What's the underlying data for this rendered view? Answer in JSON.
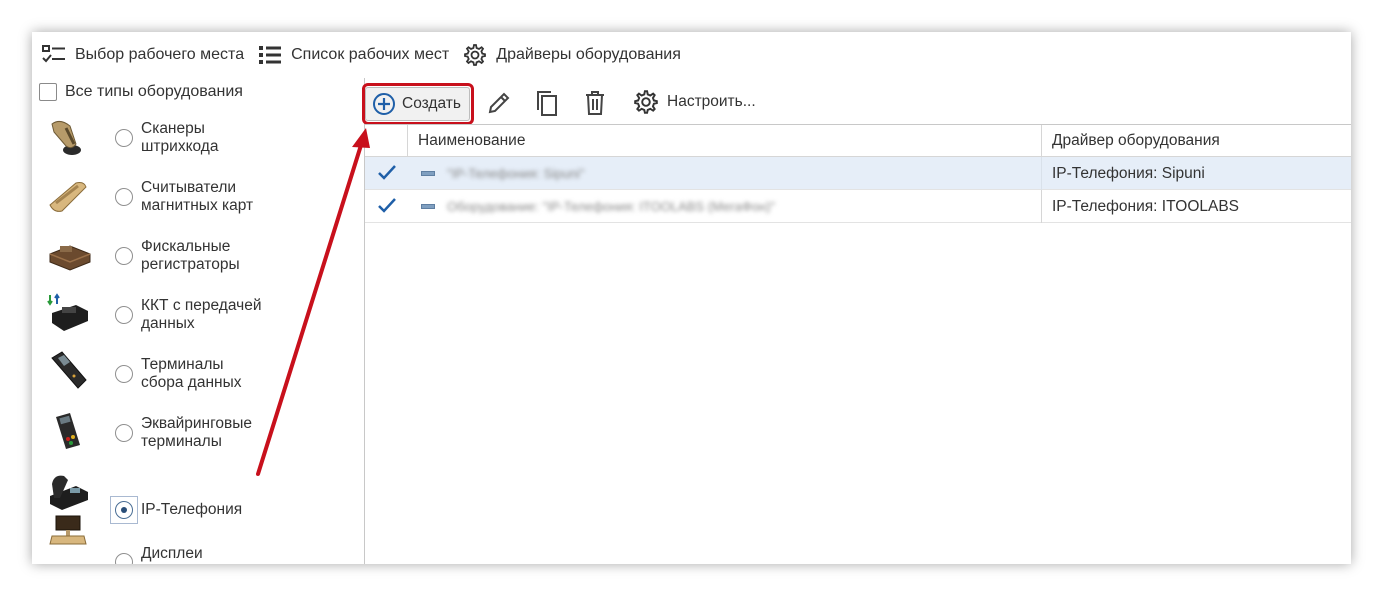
{
  "topbar": {
    "items": [
      {
        "label": "Выбор рабочего места",
        "icon": "workplace-select-icon"
      },
      {
        "label": "Список рабочих мест",
        "icon": "list-icon"
      },
      {
        "label": "Драйверы оборудования",
        "icon": "gear-icon"
      }
    ]
  },
  "filters": {
    "all_types_label": "Все типы оборудования",
    "all_types_checked": false,
    "types": [
      {
        "label": "Сканеры\nштрихкода",
        "icon": "barcode-scanner-icon",
        "selected": false
      },
      {
        "label": "Считыватели\nмагнитных карт",
        "icon": "magnetic-card-reader-icon",
        "selected": false
      },
      {
        "label": "Фискальные\nрегистраторы",
        "icon": "fiscal-registrar-icon",
        "selected": false
      },
      {
        "label": "ККТ с передачей\nданных",
        "icon": "cash-register-icon",
        "selected": false
      },
      {
        "label": "Терминалы\nсбора данных",
        "icon": "data-terminal-icon",
        "selected": false
      },
      {
        "label": "Эквайринговые\nтерминалы",
        "icon": "acquiring-terminal-icon",
        "selected": false
      },
      {
        "label": "IP-Телефония",
        "icon": "ip-phone-icon",
        "selected": true
      },
      {
        "label": "Дисплеи\nпокупателя",
        "icon": "customer-display-icon",
        "selected": false
      }
    ]
  },
  "toolbar": {
    "create_label": "Создать",
    "configure_label": "Настроить..."
  },
  "table": {
    "columns": [
      "Наименование",
      "Драйвер оборудования"
    ],
    "rows": [
      {
        "name": "\"IP-Телефония: Sipuni\"",
        "driver": "IP-Телефония: Sipuni",
        "checked": true,
        "selected": true
      },
      {
        "name": "Оборудование: \"IP-Телефония: ITOOLABS (МегаФон)\"",
        "driver": "IP-Телефония: ITOOLABS",
        "checked": true,
        "selected": false
      }
    ]
  },
  "colors": {
    "accent_blue": "#1f5fa8",
    "highlight_red": "#c8101c",
    "selected_row": "#e6eef8"
  }
}
